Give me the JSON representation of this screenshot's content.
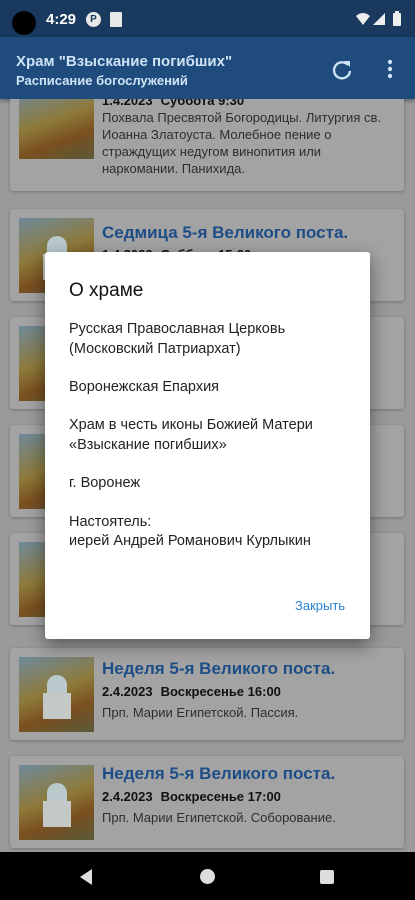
{
  "status_bar": {
    "time": "4:29"
  },
  "app_bar": {
    "title": "Храм \"Взыскание погибших\"",
    "subtitle": "Расписание богослужений"
  },
  "cards": [
    {
      "title": "",
      "date": "1.4.2023",
      "day": "Суббота 9:30",
      "desc": "Похвала Пресвятой Богородицы. Литургия св. Иоанна Златоуста. Молебное пение о страждущих недугом винопития или наркомании. Панихида."
    },
    {
      "title": "Седмица 5-я Великого поста.",
      "date": "1.4.2023",
      "day": "Суббота 15:30",
      "desc": ""
    },
    {
      "title": "Неделя 5-я Великого поста.",
      "date": "2.4.2023",
      "day": "Воскресенье 16:00",
      "desc": "Прп. Марии Египетской. Пассия."
    },
    {
      "title": "Неделя 5-я Великого поста.",
      "date": "2.4.2023",
      "day": "Воскресенье 17:00",
      "desc": "Прп. Марии Египетской. Соборование."
    }
  ],
  "dialog": {
    "title": "О храме",
    "church": "Русская Православная Церковь",
    "patriarchate": "(Московский Патриархат)",
    "diocese": "Воронежская Епархия",
    "temple_line1": "Храм в честь иконы Божией Матери",
    "temple_line2": "«Взыскание погибших»",
    "city": "г. Воронеж",
    "rector_label": "Настоятель:",
    "rector_name": "иерей Андрей Романович Курлыкин",
    "close_label": "Закрыть"
  }
}
